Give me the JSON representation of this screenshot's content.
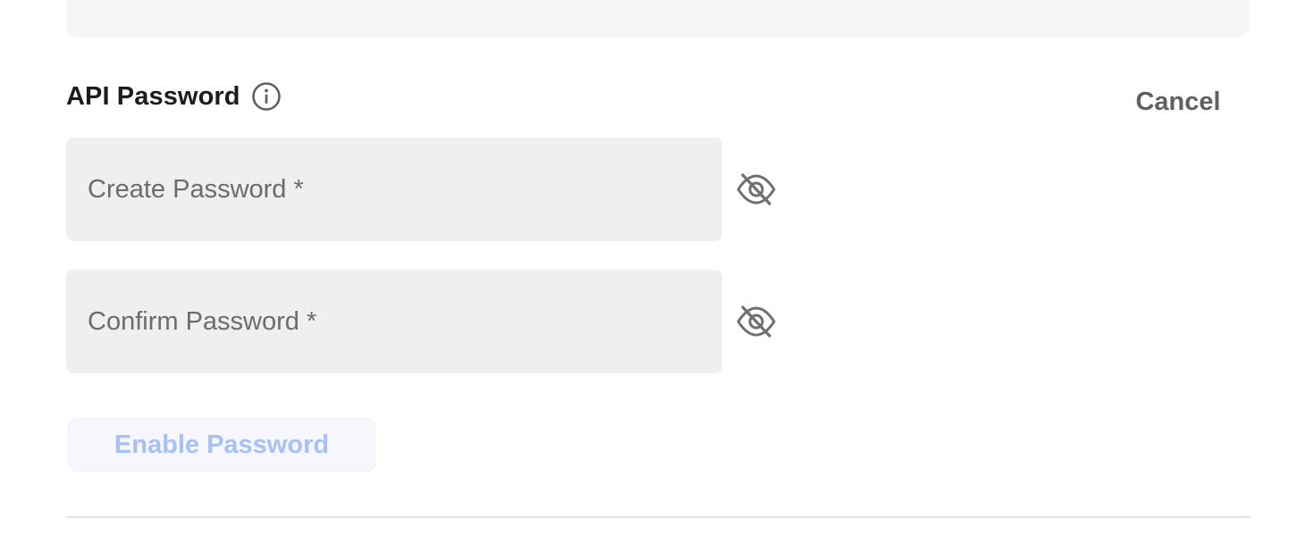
{
  "header": {
    "title": "API Password",
    "info_icon": "info-circle-icon",
    "cancel_label": "Cancel"
  },
  "form": {
    "create_password": {
      "placeholder": "Create Password *",
      "value": "",
      "visibility_icon": "eye-off-icon"
    },
    "confirm_password": {
      "placeholder": "Confirm Password *",
      "value": "",
      "visibility_icon": "eye-off-icon"
    },
    "submit_label": "Enable Password",
    "submit_enabled": false
  },
  "colors": {
    "text_primary": "#1c1c1e",
    "text_secondary": "#5f6065",
    "field_background": "#efefef",
    "panel_background": "#f6f6f6",
    "button_disabled_text": "#a9c0f4",
    "button_disabled_background": "#f5f7fd",
    "divider": "#e2e2e4"
  }
}
